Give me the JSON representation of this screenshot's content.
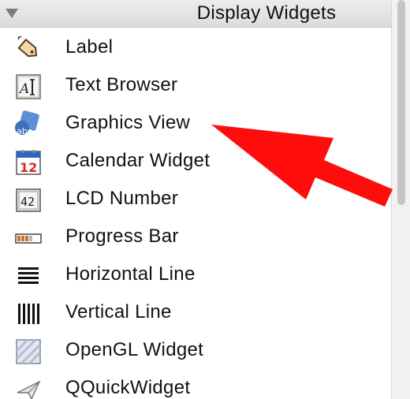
{
  "panel": {
    "header": {
      "title": "Display Widgets",
      "expand_icon": "triangle-down-icon"
    },
    "items": [
      {
        "label": "Label",
        "icon": "label-tag-icon"
      },
      {
        "label": "Text Browser",
        "icon": "text-browser-icon"
      },
      {
        "label": "Graphics View",
        "icon": "graphics-view-icon"
      },
      {
        "label": "Calendar Widget",
        "icon": "calendar-icon",
        "icon_text": "12"
      },
      {
        "label": "LCD Number",
        "icon": "lcd-number-icon",
        "icon_text": "42"
      },
      {
        "label": "Progress Bar",
        "icon": "progress-bar-icon"
      },
      {
        "label": "Horizontal Line",
        "icon": "horizontal-line-icon"
      },
      {
        "label": "Vertical Line",
        "icon": "vertical-line-icon"
      },
      {
        "label": "OpenGL Widget",
        "icon": "opengl-widget-icon"
      },
      {
        "label": "QQuickWidget",
        "icon": "qquickwidget-icon"
      }
    ]
  },
  "annotation": {
    "type": "arrow",
    "color": "#ff0000",
    "points_to": "Graphics View"
  }
}
